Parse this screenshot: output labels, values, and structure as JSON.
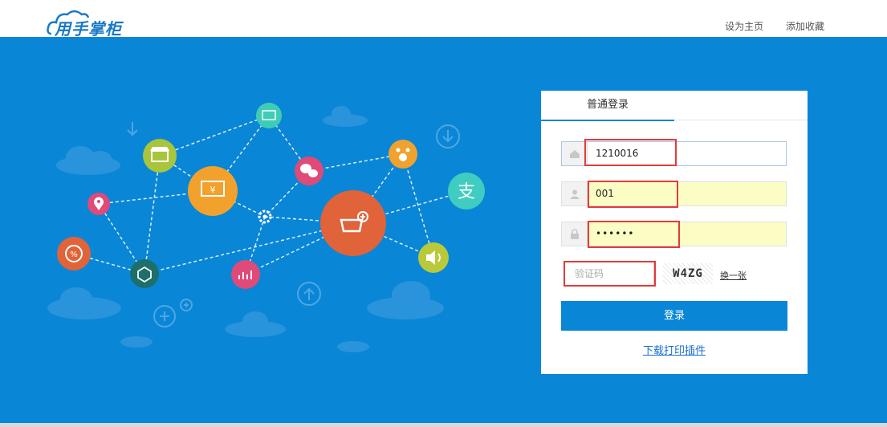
{
  "header": {
    "logo_text": "用手掌柜",
    "links": [
      "设为主页",
      "添加收藏"
    ]
  },
  "login": {
    "tab_label": "普通登录",
    "company_value": "1210016",
    "user_value": "001",
    "password_value": "••••••",
    "captcha_placeholder": "验证码",
    "captcha_text": "W4ZG",
    "refresh_label": "换一张",
    "submit_label": "登录",
    "download_label": "下载打印插件"
  },
  "colors": {
    "brand": "#0a86d6",
    "highlight": "#e53a3a",
    "autofill": "#fbfdc5"
  }
}
